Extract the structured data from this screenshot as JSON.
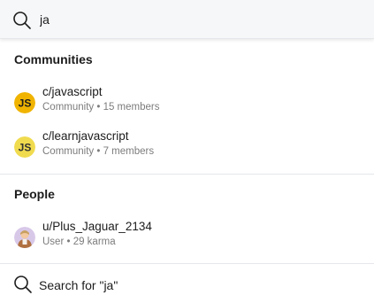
{
  "search": {
    "value": "ja",
    "icon": "search-icon"
  },
  "communities": {
    "title": "Communities",
    "items": [
      {
        "name": "c/javascript",
        "meta": "Community • 15 members",
        "icon": "javascript-community-icon",
        "icon_text": "JS",
        "icon_color": "#f0b400"
      },
      {
        "name": "c/learnjavascript",
        "meta": "Community • 7 members",
        "icon": "learnjavascript-community-icon",
        "icon_text": "JS",
        "icon_color": "#f0db4f"
      }
    ]
  },
  "people": {
    "title": "People",
    "items": [
      {
        "name": "u/Plus_Jaguar_2134",
        "meta": "User • 29 karma",
        "icon": "user-avatar-icon"
      }
    ]
  },
  "search_for": {
    "label": "Search for \"ja\"",
    "icon": "search-icon"
  },
  "colors": {
    "text": "#1c1c1c",
    "meta": "#7c7c7c",
    "divider": "#e5e7ea",
    "search_bg": "#f6f7f8"
  }
}
